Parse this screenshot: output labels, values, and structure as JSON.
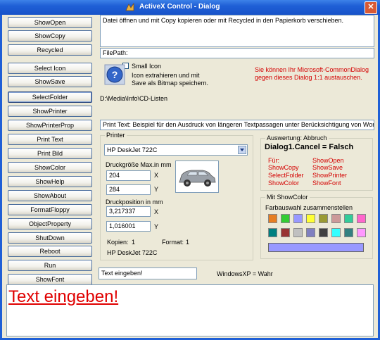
{
  "window": {
    "title": "ActiveX Control  -  Dialog",
    "close_glyph": "✕"
  },
  "buttons": [
    "ShowOpen",
    "ShowCopy",
    "Recycled",
    "Select Icon",
    "ShowSave",
    "SelectFolder",
    "ShowPrinter",
    "ShowPrinterProp",
    "Print Text",
    "Print Bild",
    "ShowColor",
    "ShowHelp",
    "ShowAbout",
    "FormatFloppy",
    "ObjectProperty",
    "ShutDown",
    "Reboot",
    "Run",
    "ShowFont"
  ],
  "info_text": "Datei öffnen und mit Copy kopieren oder mit Recycled in den Papierkorb verschieben.",
  "filepath": "FilePath:",
  "icon_section": {
    "checkbox_label": "Small Icon",
    "desc_line1": "Icon extrahieren und mit",
    "desc_line2": "Save als Bitmap speichern.",
    "icon": "help-question-icon"
  },
  "red_note_line1": "Sie können Ihr Microsoft-CommonDialog",
  "red_note_line2": "gegen dieses Dialog 1:1 austauschen.",
  "folder_path": "D:\\Media\\Info\\CD-Listen",
  "print_text": "Print Text: Beispiel für den Ausdruck von längeren Textpassagen unter Berücksichtigung von Wort",
  "printer": {
    "group_title": "Printer",
    "selected": "HP DeskJet 722C",
    "size_label": "Druckgröße Max.in mm",
    "size_x": "204",
    "size_y": "284",
    "x_label": "X",
    "y_label": "Y",
    "pos_label": "Druckposition in mm",
    "pos_x": "3,217337",
    "pos_y": "1,016001",
    "copies_label": "Kopien:",
    "copies": "1",
    "format_label": "Format:",
    "format": "1",
    "printer_name": "HP DeskJet 722C"
  },
  "auswertung": {
    "group_title": "Auswertung: Abbruch",
    "result": "Dialog1.Cancel = Falsch",
    "fuer_label": "Für:",
    "items_left": [
      "ShowCopy",
      "SelectFolder",
      "ShowColor"
    ],
    "items_right": [
      "ShowOpen",
      "ShowSave",
      "ShowPrinter",
      "ShowFont"
    ]
  },
  "showcolor": {
    "group_title": "Mit ShowColor",
    "subtitle": "Farbauswahl zusammenstellen",
    "row1": [
      "#E67E22",
      "#33CC33",
      "#9999FF",
      "#FFFF33",
      "#9A9A33",
      "#CC9999",
      "#33CC99",
      "#FF66CC"
    ],
    "row2": [
      "#008080",
      "#993333",
      "#C0C0C0",
      "#8080C0",
      "#404040",
      "#33FFFF",
      "#338080",
      "#FF99FF"
    ],
    "bar_color": "#9999FF"
  },
  "text_input": "Text eingeben!",
  "windowsxp": "WindowsXP = Wahr",
  "big_text": "Text eingeben!"
}
